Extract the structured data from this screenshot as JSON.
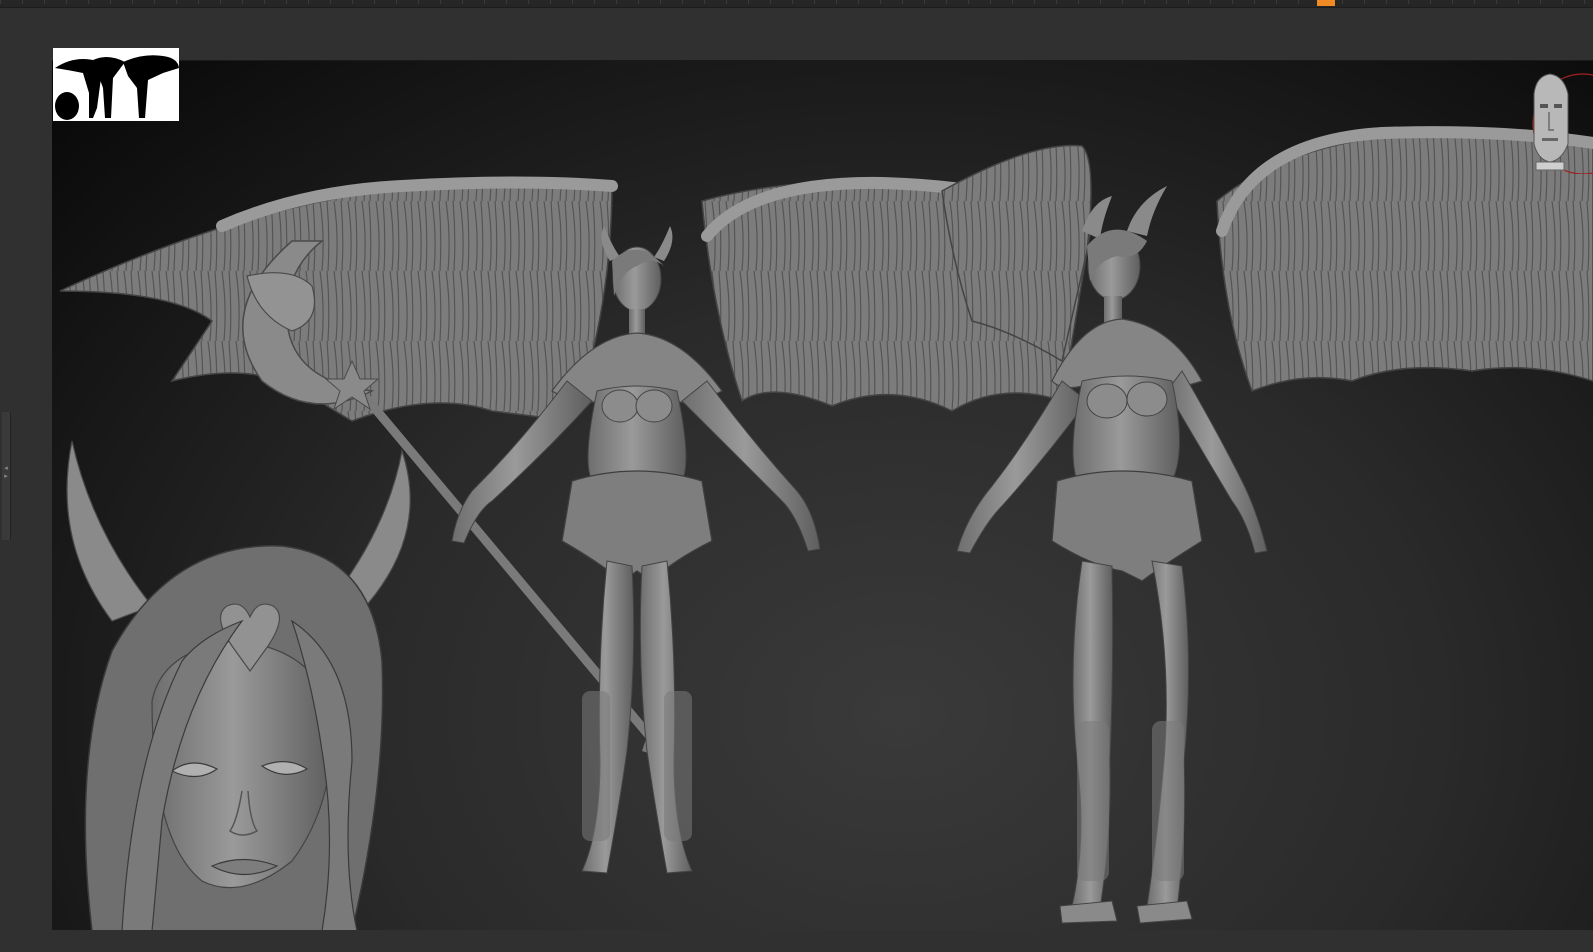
{
  "app": {
    "accent_color": "#f08a24",
    "background_color": "#303030"
  },
  "toolbar": {
    "marker_icon": "timeline-marker-icon"
  },
  "left_tray": {
    "handle_icon": "tray-collapse-icon"
  },
  "viewport": {
    "thumbnail_icon": "silhouette-thumbnail",
    "gizmo_icon": "navigation-head-icon",
    "model_color": "#8c8c8c"
  }
}
